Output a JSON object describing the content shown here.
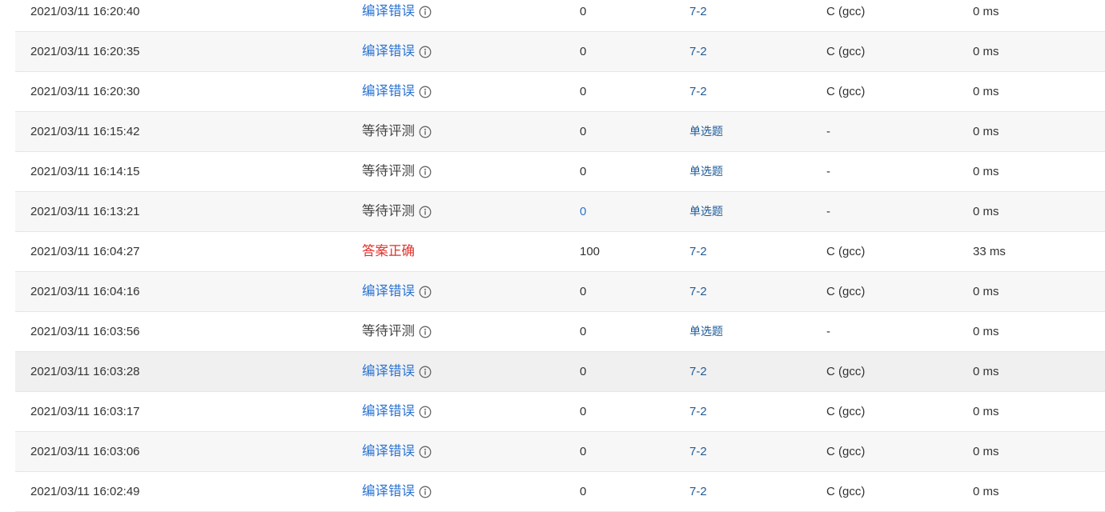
{
  "colors": {
    "compile_error": "#2d74d1",
    "pending": "#444444",
    "accepted": "#e0312b",
    "link": "#1f5c99",
    "score_link": "#2d74d1",
    "row_stripe": "#f7f7f7",
    "row_hover": "#f0f0f0"
  },
  "submissions": [
    {
      "time": "2021/03/11 16:20:40",
      "status": "编译错误",
      "status_type": "compile_error",
      "has_info": true,
      "score": "0",
      "score_link": false,
      "problem": "7-2",
      "problem_type": "code",
      "compiler": "C (gcc)",
      "time_used": "0 ms"
    },
    {
      "time": "2021/03/11 16:20:35",
      "status": "编译错误",
      "status_type": "compile_error",
      "has_info": true,
      "score": "0",
      "score_link": false,
      "problem": "7-2",
      "problem_type": "code",
      "compiler": "C (gcc)",
      "time_used": "0 ms"
    },
    {
      "time": "2021/03/11 16:20:30",
      "status": "编译错误",
      "status_type": "compile_error",
      "has_info": true,
      "score": "0",
      "score_link": false,
      "problem": "7-2",
      "problem_type": "code",
      "compiler": "C (gcc)",
      "time_used": "0 ms"
    },
    {
      "time": "2021/03/11 16:15:42",
      "status": "等待评测",
      "status_type": "pending",
      "has_info": true,
      "score": "0",
      "score_link": false,
      "problem": "单选题",
      "problem_type": "choice",
      "compiler": "-",
      "time_used": "0 ms"
    },
    {
      "time": "2021/03/11 16:14:15",
      "status": "等待评测",
      "status_type": "pending",
      "has_info": true,
      "score": "0",
      "score_link": false,
      "problem": "单选题",
      "problem_type": "choice",
      "compiler": "-",
      "time_used": "0 ms"
    },
    {
      "time": "2021/03/11 16:13:21",
      "status": "等待评测",
      "status_type": "pending",
      "has_info": true,
      "score": "0",
      "score_link": true,
      "problem": "单选题",
      "problem_type": "choice",
      "compiler": "-",
      "time_used": "0 ms"
    },
    {
      "time": "2021/03/11 16:04:27",
      "status": "答案正确",
      "status_type": "accepted",
      "has_info": false,
      "score": "100",
      "score_link": false,
      "problem": "7-2",
      "problem_type": "code",
      "compiler": "C (gcc)",
      "time_used": "33 ms"
    },
    {
      "time": "2021/03/11 16:04:16",
      "status": "编译错误",
      "status_type": "compile_error",
      "has_info": true,
      "score": "0",
      "score_link": false,
      "problem": "7-2",
      "problem_type": "code",
      "compiler": "C (gcc)",
      "time_used": "0 ms"
    },
    {
      "time": "2021/03/11 16:03:56",
      "status": "等待评测",
      "status_type": "pending",
      "has_info": true,
      "score": "0",
      "score_link": false,
      "problem": "单选题",
      "problem_type": "choice",
      "compiler": "-",
      "time_used": "0 ms"
    },
    {
      "time": "2021/03/11 16:03:28",
      "status": "编译错误",
      "status_type": "compile_error",
      "has_info": true,
      "score": "0",
      "score_link": false,
      "problem": "7-2",
      "problem_type": "code",
      "compiler": "C (gcc)",
      "time_used": "0 ms",
      "hover": true
    },
    {
      "time": "2021/03/11 16:03:17",
      "status": "编译错误",
      "status_type": "compile_error",
      "has_info": true,
      "score": "0",
      "score_link": false,
      "problem": "7-2",
      "problem_type": "code",
      "compiler": "C (gcc)",
      "time_used": "0 ms"
    },
    {
      "time": "2021/03/11 16:03:06",
      "status": "编译错误",
      "status_type": "compile_error",
      "has_info": true,
      "score": "0",
      "score_link": false,
      "problem": "7-2",
      "problem_type": "code",
      "compiler": "C (gcc)",
      "time_used": "0 ms"
    },
    {
      "time": "2021/03/11 16:02:49",
      "status": "编译错误",
      "status_type": "compile_error",
      "has_info": true,
      "score": "0",
      "score_link": false,
      "problem": "7-2",
      "problem_type": "code",
      "compiler": "C (gcc)",
      "time_used": "0 ms"
    }
  ]
}
